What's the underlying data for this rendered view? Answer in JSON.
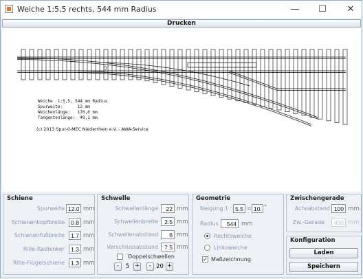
{
  "window": {
    "title": "Weiche 1:5,5 rechts, 544 mm Radius",
    "controls": [
      "—",
      "☐",
      "✕"
    ]
  },
  "toolbar": {
    "print_label": "Drucken"
  },
  "plan": {
    "info_lines": [
      "Weiche  1:5,5, 544 mm Radius",
      "Spurweite:      12 mm",
      "Weichenlänge:   176,0 mm",
      "Tangentenlänge:  49,1 mm"
    ],
    "copyright": "(c) 2013 Spur-0-MEC Niederrhein e.V. -  AWA-Service"
  },
  "schiene": {
    "title": "Schiene",
    "rows": [
      {
        "label": "Spurweite",
        "value": "12.0",
        "unit": "mm"
      },
      {
        "label": "Schienenkopfbreite",
        "value": "0.8",
        "unit": "mm"
      },
      {
        "label": "Schienenfußbreite",
        "value": "1.7",
        "unit": "mm"
      },
      {
        "label": "Rille-Radlenker",
        "value": "1.3",
        "unit": "mm"
      },
      {
        "label": "Rille-Flügelschiene",
        "value": "1.3",
        "unit": "mm"
      }
    ]
  },
  "schwelle": {
    "title": "Schwelle",
    "rows": [
      {
        "label": "Schwellenlänge",
        "value": "22",
        "unit": "mm"
      },
      {
        "label": "Schwellenbreite",
        "value": "2.5",
        "unit": "mm"
      },
      {
        "label": "Schwellenabstand",
        "value": "6",
        "unit": "mm"
      },
      {
        "label": "Verschlussabstand",
        "value": "7.5",
        "unit": "mm"
      }
    ],
    "doppelschwellen_label": "Doppelschwellen",
    "spinner1": {
      "minus": "-",
      "value": "5",
      "plus": "+"
    },
    "spinner2": {
      "minus": "-",
      "value": "20",
      "plus": "+"
    }
  },
  "geometrie": {
    "title": "Geometrie",
    "neigung_label": "Neigung  1 :",
    "neigung_value": "5.5",
    "neigung_sep": "=",
    "neigung_angle": "10.3",
    "neigung_unit": "°",
    "radius_label": "Radius",
    "radius_value": "544",
    "radius_unit": "mm",
    "rechtsweiche_label": "Rechtsweiche",
    "linksweiche_label": "Linksweiche",
    "masszeichnung_label": "Maßzeichnung",
    "selected": "Rechtsweiche",
    "masszeichnung_checked": true
  },
  "zwischengerade": {
    "title": "Zwischengerade",
    "achsabstand_label": "Achsabstand",
    "achsabstand_value": "100",
    "achsabstand_unit": "mm",
    "zw_gerade_label": "Zw.-Gerade",
    "zw_gerade_value": "460",
    "zw_gerade_unit": "mm"
  },
  "konfiguration": {
    "title": "Konfiguration",
    "load_label": "Laden",
    "save_label": "Speichern"
  }
}
